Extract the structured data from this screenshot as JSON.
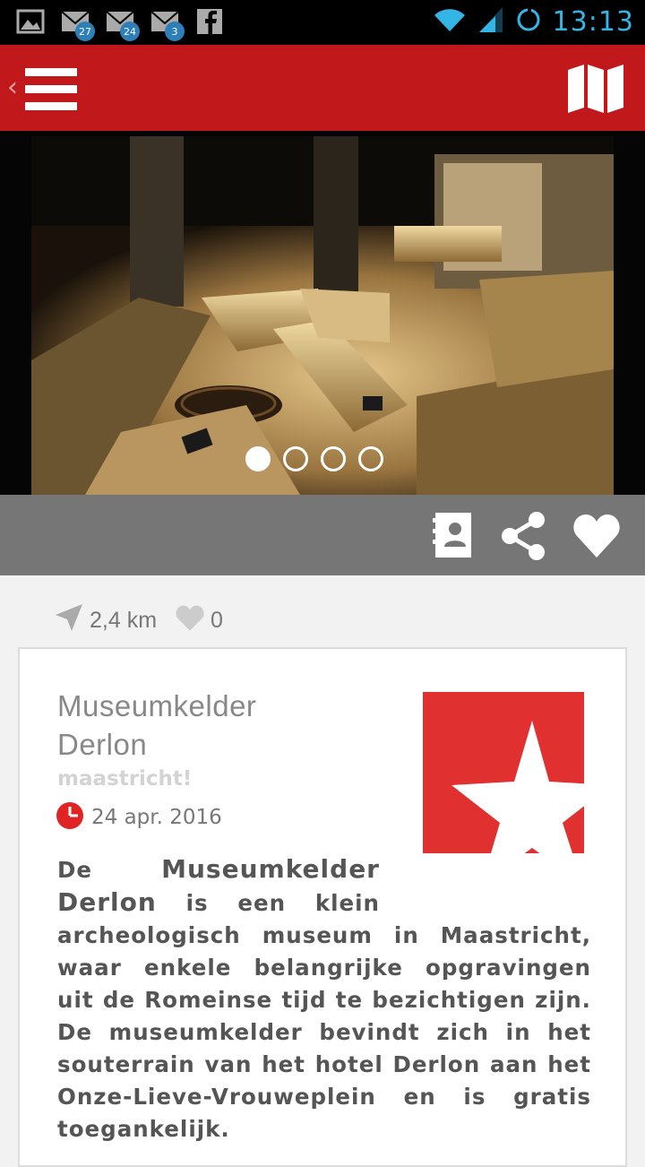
{
  "status_bar": {
    "time": "13:13",
    "notifications": [
      {
        "icon": "image-icon"
      },
      {
        "icon": "mail-icon",
        "badge": "27"
      },
      {
        "icon": "mail-icon",
        "badge": "24"
      },
      {
        "icon": "mail-icon",
        "badge": "3"
      },
      {
        "icon": "facebook-icon"
      }
    ],
    "accent_color": "#33b5e5"
  },
  "app_bar": {
    "color": "#c1191b",
    "left_icon": "hamburger-menu-icon",
    "right_icon": "map-icon"
  },
  "gallery": {
    "page_count": 4,
    "active_index": 0
  },
  "actions": [
    {
      "icon": "contact-card-icon"
    },
    {
      "icon": "share-icon"
    },
    {
      "icon": "heart-icon"
    }
  ],
  "meta": {
    "distance": "2,4 km",
    "likes": "0"
  },
  "article": {
    "title_line1": "Museumkelder",
    "title_line2": "Derlon",
    "source": "maastricht!",
    "date": "24 apr. 2016",
    "body_line1_a": "De",
    "body_line1_b": "Museumkelder",
    "body_line2_a": "Derlon",
    "body_line2_b": "is een klein",
    "body_rest": "archeologisch museum in Maastricht, waar enkele belangrijke opgravingen uit de Romeinse tijd te bezichtigen zijn. De museumkelder bevindt zich in het souterrain van het hotel Derlon aan het Onze-Lieve-Vrouweplein en is gratis toegankelijk."
  }
}
